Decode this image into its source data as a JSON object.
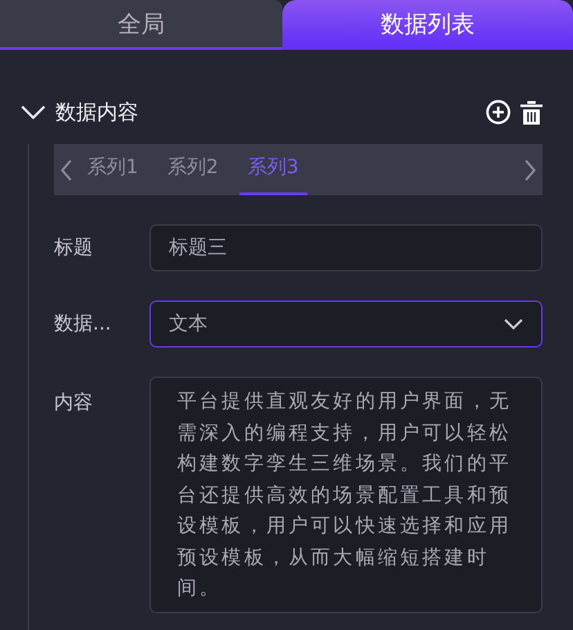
{
  "tabs": [
    {
      "label": "全局",
      "selected": false
    },
    {
      "label": "数据列表",
      "selected": true
    }
  ],
  "section": {
    "title": "数据内容",
    "expanded": true,
    "series_tabs": [
      {
        "label": "系列1",
        "selected": false
      },
      {
        "label": "系列2",
        "selected": false
      },
      {
        "label": "系列3",
        "selected": true
      }
    ],
    "fields": [
      {
        "kind": "input",
        "label": "标题",
        "value": "标题三",
        "focused": false
      },
      {
        "kind": "select",
        "label": "数据...",
        "value": "文本",
        "focused": true
      },
      {
        "kind": "textarea",
        "label": "内容",
        "value": "平台提供直观友好的用户界面，无需深入的编程支持，用户可以轻松构建数字孪生三维场景。我们的平台还提供高效的场景配置工具和预设模板，用户可以快速选择和应用预设模板，从而大幅缩短搭建时间。",
        "focused": false
      }
    ]
  }
}
